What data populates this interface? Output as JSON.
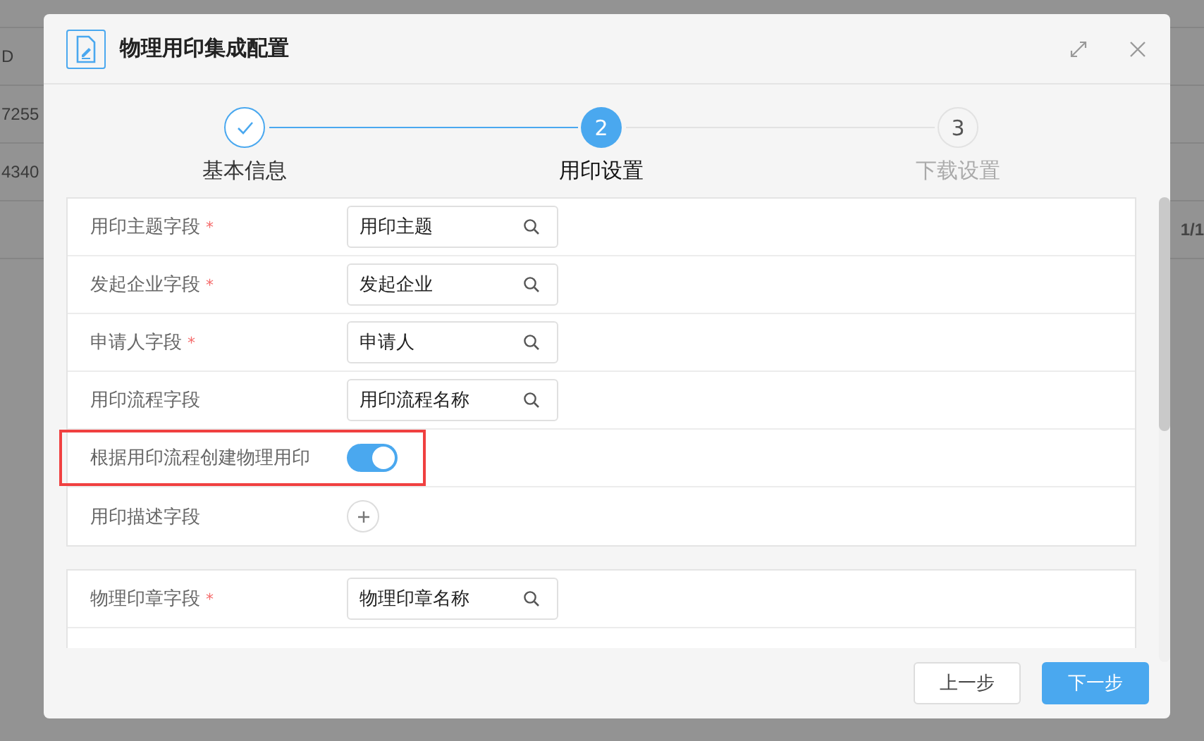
{
  "background_rows": [
    "D",
    "7255",
    "4340"
  ],
  "background_pager": "1/1",
  "dialog": {
    "title": "物理用印集成配置"
  },
  "steps": [
    {
      "label": "基本信息",
      "completed": true,
      "selected": false
    },
    {
      "number": "2",
      "label": "用印设置",
      "completed": false,
      "selected": true
    },
    {
      "number": "3",
      "label": "下载设置",
      "completed": false,
      "selected": false
    }
  ],
  "sections": [
    {
      "fields": [
        {
          "label": "用印主题字段",
          "required_mark": "*",
          "kind": "search",
          "value": "用印主题",
          "highlighted": false
        },
        {
          "label": "发起企业字段",
          "required_mark": "*",
          "kind": "search",
          "value": "发起企业",
          "highlighted": false
        },
        {
          "label": "申请人字段",
          "required_mark": "*",
          "kind": "search",
          "value": "申请人",
          "highlighted": false
        },
        {
          "label": "用印流程字段",
          "kind": "search",
          "value": "用印流程名称",
          "highlighted": false
        },
        {
          "label": "根据用印流程创建物理用印",
          "kind": "switch",
          "on": true,
          "highlighted": true
        },
        {
          "label": "用印描述字段",
          "kind": "add",
          "highlighted": false
        }
      ]
    },
    {
      "fields": [
        {
          "label": "物理印章字段",
          "required_mark": "*",
          "kind": "search",
          "value": "物理印章名称",
          "highlighted": false
        }
      ]
    }
  ],
  "buttons": [
    {
      "label": "上一步",
      "kind": "secondary"
    },
    {
      "label": "下一步",
      "kind": "primary"
    }
  ]
}
